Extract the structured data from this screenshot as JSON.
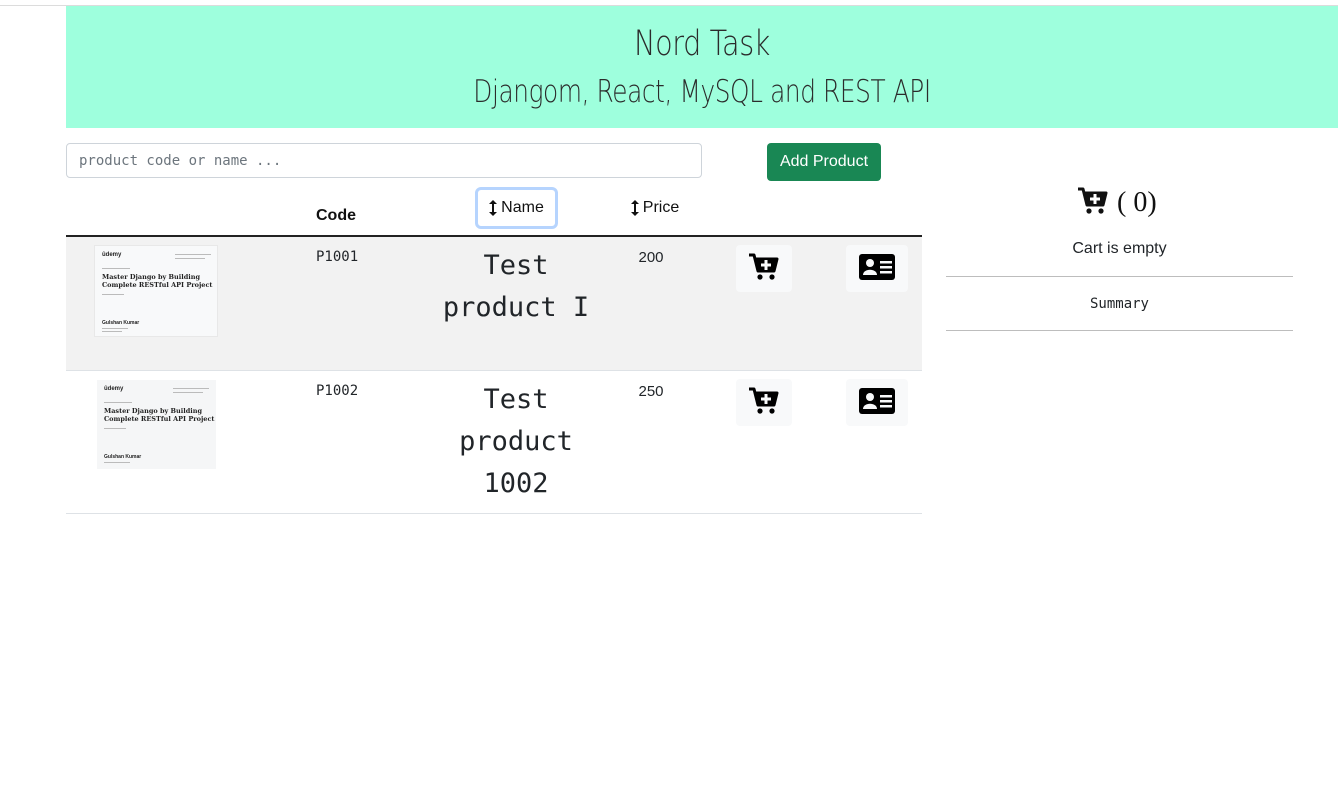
{
  "header": {
    "title": "Nord Task",
    "subtitle": "Djangom, React, MySQL and REST API"
  },
  "toolbar": {
    "search_placeholder": "product code or name ...",
    "search_value": "",
    "add_button_label": "Add Product"
  },
  "table": {
    "columns": {
      "code": "Code",
      "name": "Name",
      "price": "Price"
    },
    "rows": [
      {
        "code": "P1001",
        "name": "Test product I",
        "price": "200",
        "thumb": {
          "brand": "ûdemy",
          "title": "Master Django by Building Complete RESTful API Project",
          "person": "Gulshan Kumar"
        }
      },
      {
        "code": "P1002",
        "name": "Test product 1002",
        "price": "250",
        "thumb": {
          "brand": "ûdemy",
          "title": "Master Django by Building Complete RESTful API Project",
          "person": "Gulshan Kumar"
        }
      }
    ]
  },
  "cart": {
    "count_text": "( 0)",
    "empty_text": "Cart is empty",
    "summary_label": "Summary"
  },
  "colors": {
    "banner_bg": "#9effdd",
    "primary_button": "#198754",
    "row_highlight": "#f2f2f2",
    "focus_ring": "#b6d4fe"
  },
  "icons": {
    "sort": "sort-vertical-arrow",
    "add_to_cart": "cart-plus-icon",
    "details": "id-card-icon"
  }
}
